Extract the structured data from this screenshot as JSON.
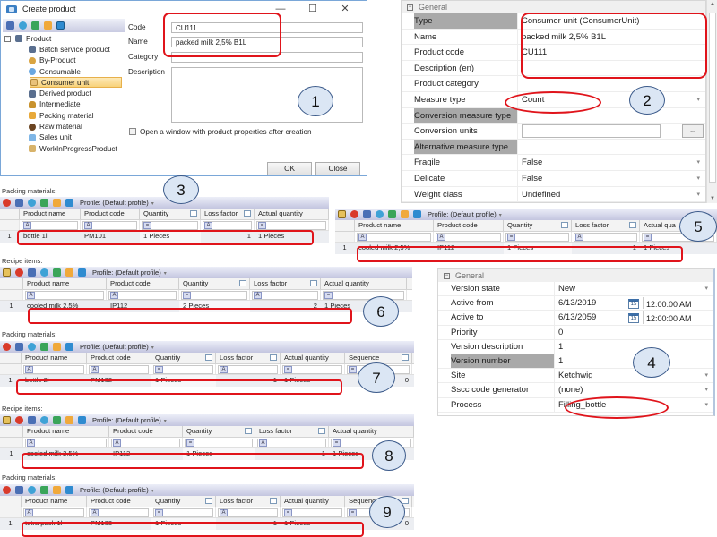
{
  "dialog": {
    "title": "Create product",
    "window_buttons": {
      "minimize": "—",
      "maximize": "☐",
      "close": "✕"
    },
    "tree": {
      "root": "Product",
      "items": [
        "Batch service product",
        "By-Product",
        "Consumable",
        "Consumer unit",
        "Derived product",
        "Intermediate",
        "Packing material",
        "Raw material",
        "Sales unit",
        "WorkInProgressProduct"
      ],
      "selected": "Consumer unit"
    },
    "form": {
      "code_label": "Code",
      "code_value": "CU111",
      "name_label": "Name",
      "name_value": "packed milk 2,5% B1L",
      "category_label": "Category",
      "category_value": "",
      "description_label": "Description",
      "description_value": "",
      "open_window_label": "Open a window with product properties after creation"
    },
    "ok_label": "OK",
    "close_label": "Close"
  },
  "callouts": [
    "1",
    "2",
    "3",
    "4",
    "5",
    "6",
    "7",
    "8",
    "9"
  ],
  "product_properties": {
    "category": "General",
    "rows": [
      {
        "key": "Type",
        "value": "Consumer unit (ConsumerUnit)",
        "highlight": true
      },
      {
        "key": "Name",
        "value": "packed milk 2,5% B1L"
      },
      {
        "key": "Product code",
        "value": "CU111"
      },
      {
        "key": "Description (en)",
        "value": ""
      },
      {
        "key": "Product category",
        "value": ""
      },
      {
        "key": "Measure type",
        "value": "Count",
        "dropdown": true
      },
      {
        "key": "Conversion measure type",
        "value": "",
        "highlight": true
      },
      {
        "key": "Conversion units",
        "value": "",
        "button": "..."
      },
      {
        "key": "Alternative measure type",
        "value": "",
        "highlight": true
      },
      {
        "key": "Fragile",
        "value": "False",
        "dropdown": true
      },
      {
        "key": "Delicate",
        "value": "False",
        "dropdown": true
      },
      {
        "key": "Weight class",
        "value": "Undefined",
        "dropdown": true
      }
    ]
  },
  "version_properties": {
    "category": "General",
    "rows": [
      {
        "key": "Version state",
        "value": "New",
        "dropdown": true
      },
      {
        "key": "Active from",
        "value": "6/13/2019",
        "time": "12:00:00 AM",
        "calendar_day": "15"
      },
      {
        "key": "Active to",
        "value": "6/13/2059",
        "time": "12:00:00 AM",
        "calendar_day": "15"
      },
      {
        "key": "Priority",
        "value": "0"
      },
      {
        "key": "Version description",
        "value": "1"
      },
      {
        "key": "Version number",
        "value": "1",
        "highlight": true
      },
      {
        "key": "Site",
        "value": "Ketchwig",
        "dropdown": true
      },
      {
        "key": "Sscc code generator",
        "value": "(none)",
        "dropdown": true
      },
      {
        "key": "Process",
        "value": "Filling_bottle",
        "dropdown": true
      }
    ]
  },
  "profile_label": "Profile: (Default profile)",
  "grids": {
    "g3": {
      "label": "Packing materials:",
      "columns": [
        "Product name",
        "Product code",
        "Quantity",
        "Loss factor",
        "Actual quantity"
      ],
      "rows": [
        {
          "index": "1",
          "cells": [
            "bottle 1l",
            "PM101",
            "1 Pieces",
            "1",
            "1 Pieces"
          ]
        }
      ]
    },
    "g5": {
      "columns": [
        "Product name",
        "Product code",
        "Quantity",
        "Loss factor",
        "Actual qua"
      ],
      "rows": [
        {
          "index": "1",
          "cells": [
            "cooled milk 2,5%",
            "IP112",
            "1 Pieces",
            "1",
            "1 Pieces"
          ]
        }
      ]
    },
    "g6": {
      "label": "Recipe items:",
      "columns": [
        "Product name",
        "Product code",
        "Quantity",
        "Loss factor",
        "Actual quantity"
      ],
      "rows": [
        {
          "index": "1",
          "cells": [
            "cooled milk 2,5%",
            "IP112",
            "2 Pieces",
            "2",
            "1 Pieces"
          ]
        }
      ]
    },
    "g7": {
      "label": "Packing materials:",
      "columns": [
        "Product name",
        "Product code",
        "Quantity",
        "Loss factor",
        "Actual quantity",
        "Sequence"
      ],
      "rows": [
        {
          "index": "1",
          "cells": [
            "bottle 2l",
            "PM102",
            "1 Pieces",
            "1",
            "1 Pieces",
            "0"
          ]
        }
      ]
    },
    "g8": {
      "label": "Recipe items:",
      "columns": [
        "Product name",
        "Product code",
        "Quantity",
        "Loss factor",
        "Actual quantity"
      ],
      "rows": [
        {
          "index": "1",
          "cells": [
            "cooled milk 2,5%",
            "IP112",
            "1 Pieces",
            "1",
            "1 Pieces"
          ]
        }
      ]
    },
    "g9": {
      "label": "Packing materials:",
      "columns": [
        "Product name",
        "Product code",
        "Quantity",
        "Loss factor",
        "Actual quantity",
        "Sequence"
      ],
      "rows": [
        {
          "index": "1",
          "cells": [
            "tetra pack 1l",
            "PM103",
            "1 Pieces",
            "1",
            "1 Pieces",
            "0"
          ]
        }
      ]
    }
  },
  "colors": {
    "highlight_red": "#e0141b",
    "callout_fill": "#dbe6f4",
    "toolbar_gradient_end": "#c3c5df",
    "selected_tree_item": "#f8d27a"
  }
}
